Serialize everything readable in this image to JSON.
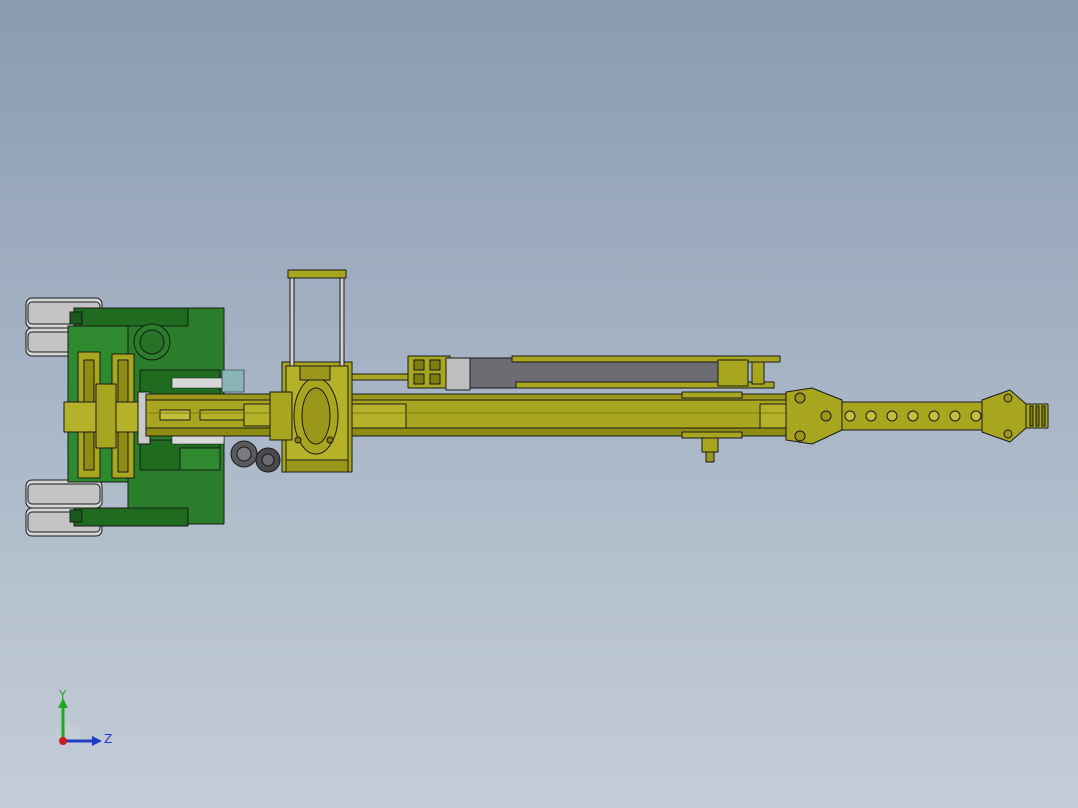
{
  "view": {
    "background_top": "#8a9bb0",
    "background_bottom": "#c3ccd7",
    "model_name": "",
    "colors": {
      "body_yellow": "#a8a51e",
      "body_yellow_dark": "#7f7c10",
      "frame_green": "#2a7d2a",
      "frame_green_dark": "#1a5a1a",
      "tire_grey": "#d4d4d4",
      "cylinder_grey": "#6c6c72",
      "outline": "#1a1a1a"
    }
  },
  "triad": {
    "y_label": "Y",
    "z_label": "Z",
    "y_color": "#1eaa1e",
    "z_color": "#1e3cc8",
    "x_color": "#c81e1e"
  }
}
